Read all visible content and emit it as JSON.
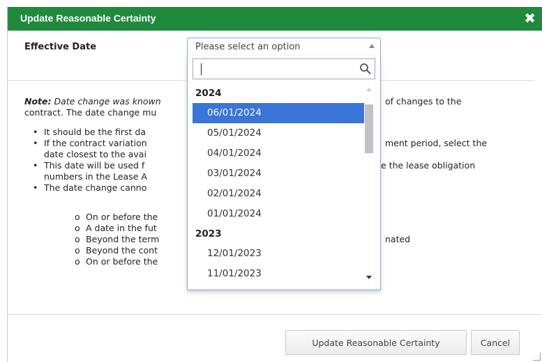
{
  "dialog": {
    "title": "Update Reasonable Certainty",
    "close_symbol": "✖",
    "effective_date_label": "Effective Date"
  },
  "select": {
    "value": "Please select an option",
    "search_placeholder": "",
    "groups": [
      {
        "label": "2024",
        "options": [
          "06/01/2024",
          "05/01/2024",
          "04/01/2024",
          "03/01/2024",
          "02/01/2024",
          "01/01/2024"
        ]
      },
      {
        "label": "2023",
        "options": [
          "12/01/2023",
          "11/01/2023"
        ]
      }
    ],
    "selected": "06/01/2024"
  },
  "note": {
    "label": "Note:",
    "intro_visible_1": "Date change was known",
    "intro_visible_2": "of changes to the",
    "intro_line2": "contract. The date change mu",
    "bullets": [
      "It should be the first da",
      "If the contract variation",
      "ment period, select the",
      "date closest to the avai",
      "This date will be used f",
      "e the lease obligation",
      "numbers in the Lease A",
      "The date change canno"
    ],
    "sub_bullets": [
      "On or before the",
      "A date in the fut",
      "Beyond the term",
      "nated",
      "Beyond the cont",
      "On or before the"
    ]
  },
  "footer": {
    "update_label": "Update Reasonable Certainty",
    "cancel_label": "Cancel"
  },
  "colors": {
    "titlebar": "#1f8a3c",
    "selected_option": "#3875d7",
    "dropdown_border": "#7eaee0"
  },
  "icons": {
    "close": "close-icon",
    "search": "search-icon",
    "dropdown_arrow": "chevron-up-icon"
  }
}
